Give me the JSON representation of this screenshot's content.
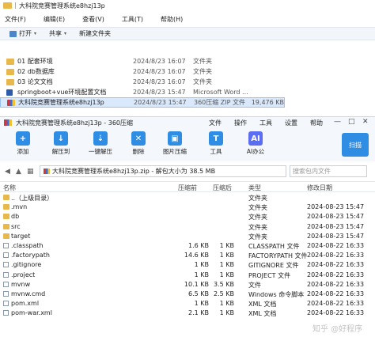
{
  "explorer": {
    "title": "大科院竞赛管理系统e8hzj13p",
    "menu": [
      "文件(F)",
      "编辑(E)",
      "查看(V)",
      "工具(T)",
      "帮助(H)"
    ],
    "toolbar": {
      "open": "打开",
      "share": "共享",
      "new_folder": "新建文件夹"
    },
    "files": [
      {
        "name": "01 配套环境",
        "date": "2024/8/23 16:07",
        "type": "文件夹",
        "size": "",
        "icon": "folder"
      },
      {
        "name": "02 db数据库",
        "date": "2024/8/23 16:07",
        "type": "文件夹",
        "size": "",
        "icon": "folder"
      },
      {
        "name": "03 论文文档",
        "date": "2024/8/23 16:07",
        "type": "文件夹",
        "size": "",
        "icon": "folder"
      },
      {
        "name": "springboot+vue环境配置文档",
        "date": "2024/8/23 15:47",
        "type": "Microsoft Word ...",
        "size": "",
        "icon": "word"
      },
      {
        "name": "大科院竞赛管理系统e8hzj13p",
        "date": "2024/8/23 15:47",
        "type": "360压缩 ZIP 文件",
        "size": "19,476 KB",
        "icon": "zip"
      }
    ]
  },
  "zip": {
    "title": "大科院竞赛管理系统e8hzj13p - 360压缩",
    "menu": [
      "文件",
      "操作",
      "工具",
      "设置",
      "帮助"
    ],
    "tools": [
      {
        "label": "添加",
        "glyph": "+"
      },
      {
        "label": "解压到",
        "glyph": "↓"
      },
      {
        "label": "一键解压",
        "glyph": "⇣"
      },
      {
        "label": "删除",
        "glyph": "✕"
      },
      {
        "label": "图片压缩",
        "glyph": "▣"
      },
      {
        "label": "工具",
        "glyph": "T"
      },
      {
        "label": "AI办公",
        "glyph": "AI"
      }
    ],
    "scan": "扫描",
    "path": "大科院竞赛管理系统e8hzj13p.zip - 解包大小为 38.5 MB",
    "search_placeholder": "搜索包内文件",
    "columns": {
      "name": "名称",
      "compressed": "压缩前",
      "after": "压缩后",
      "type": "类型",
      "modified": "修改日期"
    },
    "rows": [
      {
        "name": "..（上级目录）",
        "c": "",
        "a": "",
        "type": "文件夹",
        "date": "",
        "icon": "up"
      },
      {
        "name": ".mvn",
        "c": "",
        "a": "",
        "type": "文件夹",
        "date": "2024-08-23 15:47",
        "icon": "folder"
      },
      {
        "name": "db",
        "c": "",
        "a": "",
        "type": "文件夹",
        "date": "2024-08-23 15:47",
        "icon": "folder"
      },
      {
        "name": "src",
        "c": "",
        "a": "",
        "type": "文件夹",
        "date": "2024-08-23 15:47",
        "icon": "folder"
      },
      {
        "name": "target",
        "c": "",
        "a": "",
        "type": "文件夹",
        "date": "2024-08-23 15:47",
        "icon": "folder"
      },
      {
        "name": ".classpath",
        "c": "1.6 KB",
        "a": "1 KB",
        "type": "CLASSPATH 文件",
        "date": "2024-08-22 16:33",
        "icon": "file"
      },
      {
        "name": ".factorypath",
        "c": "14.6 KB",
        "a": "1 KB",
        "type": "FACTORYPATH 文件",
        "date": "2024-08-22 16:33",
        "icon": "file"
      },
      {
        "name": ".gitignore",
        "c": "1 KB",
        "a": "1 KB",
        "type": "GITIGNORE 文件",
        "date": "2024-08-22 16:33",
        "icon": "file"
      },
      {
        "name": ".project",
        "c": "1 KB",
        "a": "1 KB",
        "type": "PROJECT 文件",
        "date": "2024-08-22 16:33",
        "icon": "file"
      },
      {
        "name": "mvnw",
        "c": "10.1 KB",
        "a": "3.5 KB",
        "type": "文件",
        "date": "2024-08-22 16:33",
        "icon": "file"
      },
      {
        "name": "mvnw.cmd",
        "c": "6.5 KB",
        "a": "2.5 KB",
        "type": "Windows 命令脚本",
        "date": "2024-08-22 16:33",
        "icon": "file"
      },
      {
        "name": "pom.xml",
        "c": "1 KB",
        "a": "1 KB",
        "type": "XML 文档",
        "date": "2024-08-22 16:33",
        "icon": "file"
      },
      {
        "name": "pom-war.xml",
        "c": "2.1 KB",
        "a": "1 KB",
        "type": "XML 文档",
        "date": "2024-08-22 16:33",
        "icon": "file"
      }
    ]
  },
  "watermark": "知乎 @好程序"
}
